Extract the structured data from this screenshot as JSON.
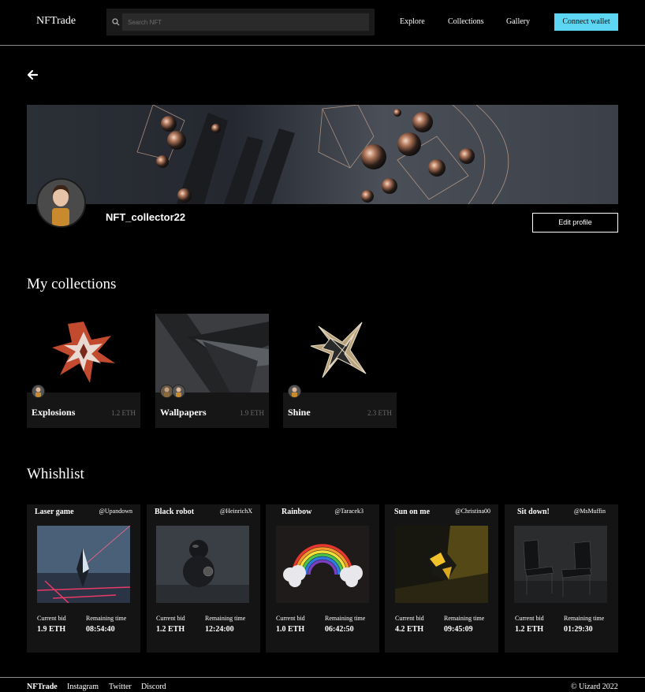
{
  "header": {
    "logo": "NFTrade",
    "search_placeholder": "Search NFT",
    "nav": [
      "Explore",
      "Collections",
      "Gallery"
    ],
    "connect_label": "Connect wallet",
    "accent": "#5cd6f2"
  },
  "profile": {
    "username": "NFT_collector22",
    "edit_label": "Edit profile"
  },
  "collections": {
    "title": "My collections",
    "items": [
      {
        "name": "Explosions",
        "price": "1.2 ETH"
      },
      {
        "name": "Wallpapers",
        "price": "1.9 ETH"
      },
      {
        "name": "Shine",
        "price": "2.3 ETH"
      }
    ]
  },
  "wishlist": {
    "title": "Whishlist",
    "bid_label": "Current bid",
    "time_label": "Remaining time",
    "items": [
      {
        "title": "Laser game",
        "user": "@Upandown",
        "bid": "1.9 ETH",
        "time": "08:54:40"
      },
      {
        "title": "Black robot",
        "user": "@HeinrichX",
        "bid": "1.2 ETH",
        "time": "12:24:00"
      },
      {
        "title": "Rainbow",
        "user": "@Taracek3",
        "bid": "1.0 ETH",
        "time": "06:42:50"
      },
      {
        "title": "Sun on me",
        "user": "@Christina00",
        "bid": "4.2 ETH",
        "time": "09:45:09"
      },
      {
        "title": "Sit down!",
        "user": "@MsMuffin",
        "bid": "1.2 ETH",
        "time": "01:29:30"
      }
    ]
  },
  "footer": {
    "links": [
      "NFTrade",
      "Instagram",
      "Twitter",
      "Discord"
    ],
    "copyright": "© Uizard 2022"
  }
}
